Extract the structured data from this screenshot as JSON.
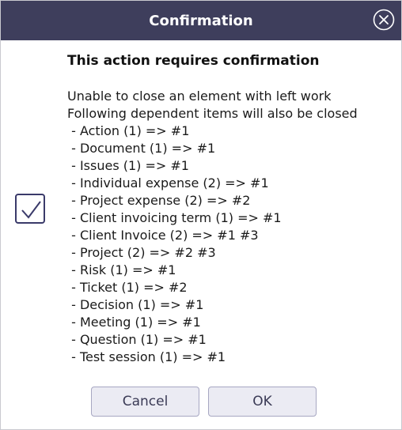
{
  "dialog": {
    "title": "Confirmation",
    "heading": "This action requires confirmation",
    "message_lines": [
      "Unable to close an element with left work",
      "Following dependent items will also be closed"
    ],
    "items": [
      " - Action (1) => #1",
      " - Document (1) => #1",
      " - Issues (1) => #1",
      " - Individual expense (2) => #1",
      " - Project expense (2) => #2",
      " - Client invoicing term (1) => #1",
      " - Client Invoice (2) => #1 #3",
      " - Project (2) => #2 #3",
      " - Risk (1) => #1",
      " - Ticket (1) => #2",
      " - Decision (1) => #1",
      " - Meeting (1) => #1",
      " - Question (1) => #1",
      " - Test session (1) => #1"
    ],
    "checkbox_checked": true,
    "cancel_label": "Cancel",
    "ok_label": "OK"
  },
  "colors": {
    "titlebar": "#3e3e5c",
    "button_bg": "#ebebf3",
    "button_border": "#a7a7c2",
    "checkbox_border": "#3a3a6a"
  },
  "icons": {
    "close": "close-circle-icon",
    "check": "check-icon"
  }
}
